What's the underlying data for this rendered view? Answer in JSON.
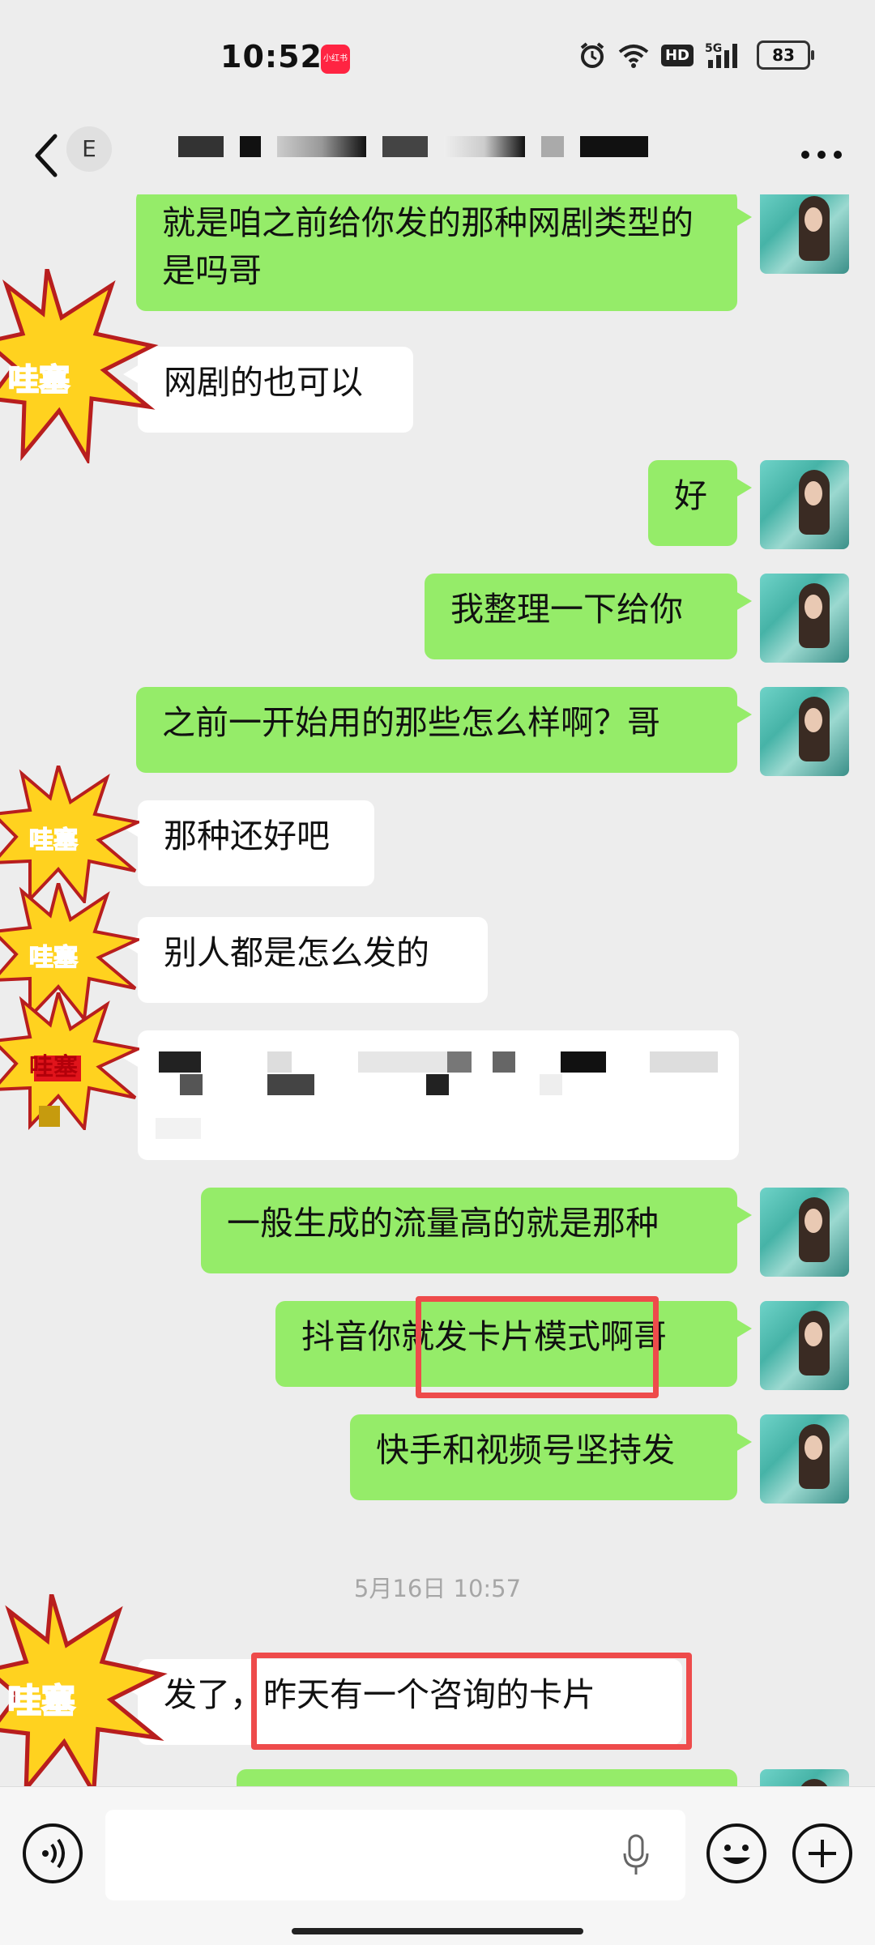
{
  "status_bar": {
    "time": "10:52",
    "app_badge": "小红书",
    "network": "5G",
    "hd": "HD",
    "battery": "83"
  },
  "nav": {
    "contact_initial": "E"
  },
  "messages": [
    {
      "side": "me",
      "text": "就是咱之前给你发的那种网剧类型的是吗哥"
    },
    {
      "side": "them",
      "text": "网剧的也可以",
      "sticker": "哇塞"
    },
    {
      "side": "me",
      "text": "好"
    },
    {
      "side": "me",
      "text": "我整理一下给你"
    },
    {
      "side": "me",
      "text": "之前一开始用的那些怎么样啊？哥"
    },
    {
      "side": "them",
      "text": "那种还好吧",
      "sticker": "哇塞"
    },
    {
      "side": "them",
      "text": "别人都是怎么发的",
      "sticker": "哇塞"
    },
    {
      "side": "them",
      "text": "",
      "sticker": "哇塞"
    },
    {
      "side": "me",
      "text": "一般生成的流量高的就是那种"
    },
    {
      "side": "me",
      "text": "抖音你就发卡片模式啊哥"
    },
    {
      "side": "me",
      "text": "快手和视频号坚持发"
    },
    {
      "side": "them",
      "text": "发了，昨天有一个咨询的卡片",
      "sticker": "哇塞"
    }
  ],
  "timestamp": "5月16日 10:57",
  "colors": {
    "me_bubble": "#95ec69",
    "them_bubble": "#ffffff",
    "highlight": "#ee4b4b",
    "sticker_fill": "#ffd21f"
  },
  "input_bar": {
    "voice_icon": "voice-icon",
    "mic_icon": "mic-icon",
    "emoji_icon": "emoji-icon",
    "plus_icon": "plus-icon"
  }
}
